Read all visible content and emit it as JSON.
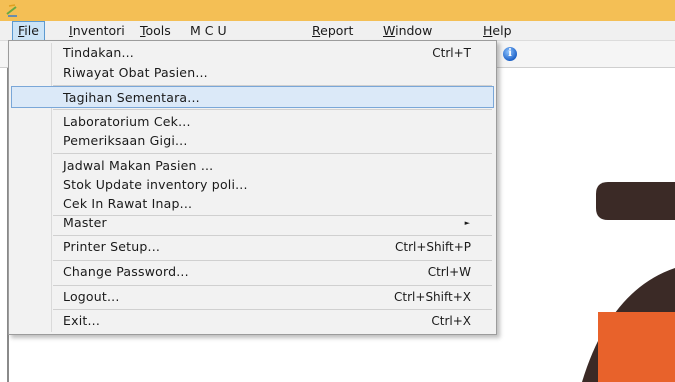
{
  "menubar": {
    "items": [
      {
        "mnemonic": "F",
        "rest": "ile"
      },
      {
        "mnemonic": "I",
        "rest": "nventori"
      },
      {
        "mnemonic": "T",
        "rest": "ools"
      },
      {
        "mnemonic": "",
        "rest": "M C U"
      },
      {
        "mnemonic": "R",
        "rest": "eport"
      },
      {
        "mnemonic": "W",
        "rest": "indow"
      },
      {
        "mnemonic": "H",
        "rest": "elp"
      }
    ]
  },
  "file_menu": {
    "items": [
      {
        "label": "Tindakan...",
        "shortcut": "Ctrl+T"
      },
      {
        "label": "Riwayat Obat Pasien...",
        "shortcut": ""
      },
      {
        "label": "Tagihan Sementara...",
        "shortcut": "",
        "highlighted": true
      },
      {
        "label": "Laboratorium Cek...",
        "shortcut": ""
      },
      {
        "label": "Pemeriksaan Gigi...",
        "shortcut": ""
      },
      {
        "label": "Jadwal Makan Pasien ...",
        "shortcut": ""
      },
      {
        "label": "Stok Update inventory poli...",
        "shortcut": ""
      },
      {
        "label": "Cek In Rawat Inap...",
        "shortcut": ""
      },
      {
        "label": "Master",
        "shortcut": "",
        "submenu": true
      },
      {
        "label": "Printer Setup...",
        "shortcut": "Ctrl+Shift+P"
      },
      {
        "label": "Change Password...",
        "shortcut": "Ctrl+W"
      },
      {
        "label": "Logout...",
        "shortcut": "Ctrl+Shift+X"
      },
      {
        "label": "Exit...",
        "shortcut": "Ctrl+X"
      }
    ]
  },
  "toolbar": {
    "info_icon": "info-icon"
  },
  "colors": {
    "titlebar": "#f4bf55",
    "menu_highlight": "#dbe9f8",
    "logo_dark": "#3b2a26",
    "logo_orange": "#e8622b"
  }
}
